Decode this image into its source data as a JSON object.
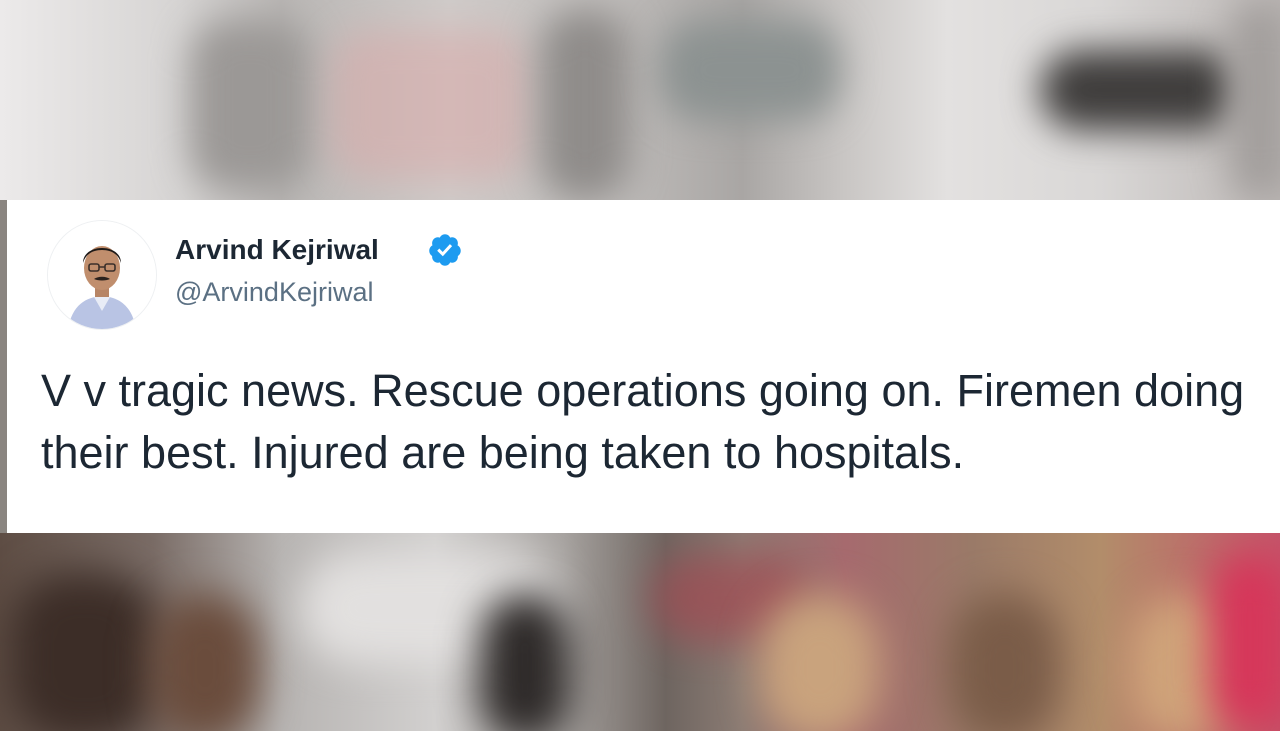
{
  "tweet": {
    "author_name": "Arvind Kejriwal",
    "author_handle": "@ArvindKejriwal",
    "verified": true,
    "text": "V v tragic news. Rescue operations going on. Firemen doing their best. Injured are being taken to hospitals."
  },
  "icons": {
    "avatar": "profile-photo",
    "verified": "verified-badge-icon"
  },
  "colors": {
    "verified_blue": "#1d9bf0",
    "name_text": "#1c2733",
    "handle_text": "#5b7083",
    "card_background": "#ffffff"
  }
}
